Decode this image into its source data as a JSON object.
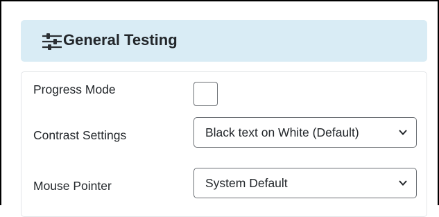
{
  "panel": {
    "title": "General Testing",
    "icon": "sliders-icon"
  },
  "settings": {
    "progress_mode": {
      "label": "Progress Mode",
      "checked": false
    },
    "contrast": {
      "label": "Contrast Settings",
      "value": "Black text on White (Default)"
    },
    "mouse_pointer": {
      "label": "Mouse Pointer",
      "value": "System Default"
    }
  },
  "colors": {
    "header_background": "#d9ecf5",
    "text": "#22262a",
    "control_border": "#6b6f74"
  }
}
